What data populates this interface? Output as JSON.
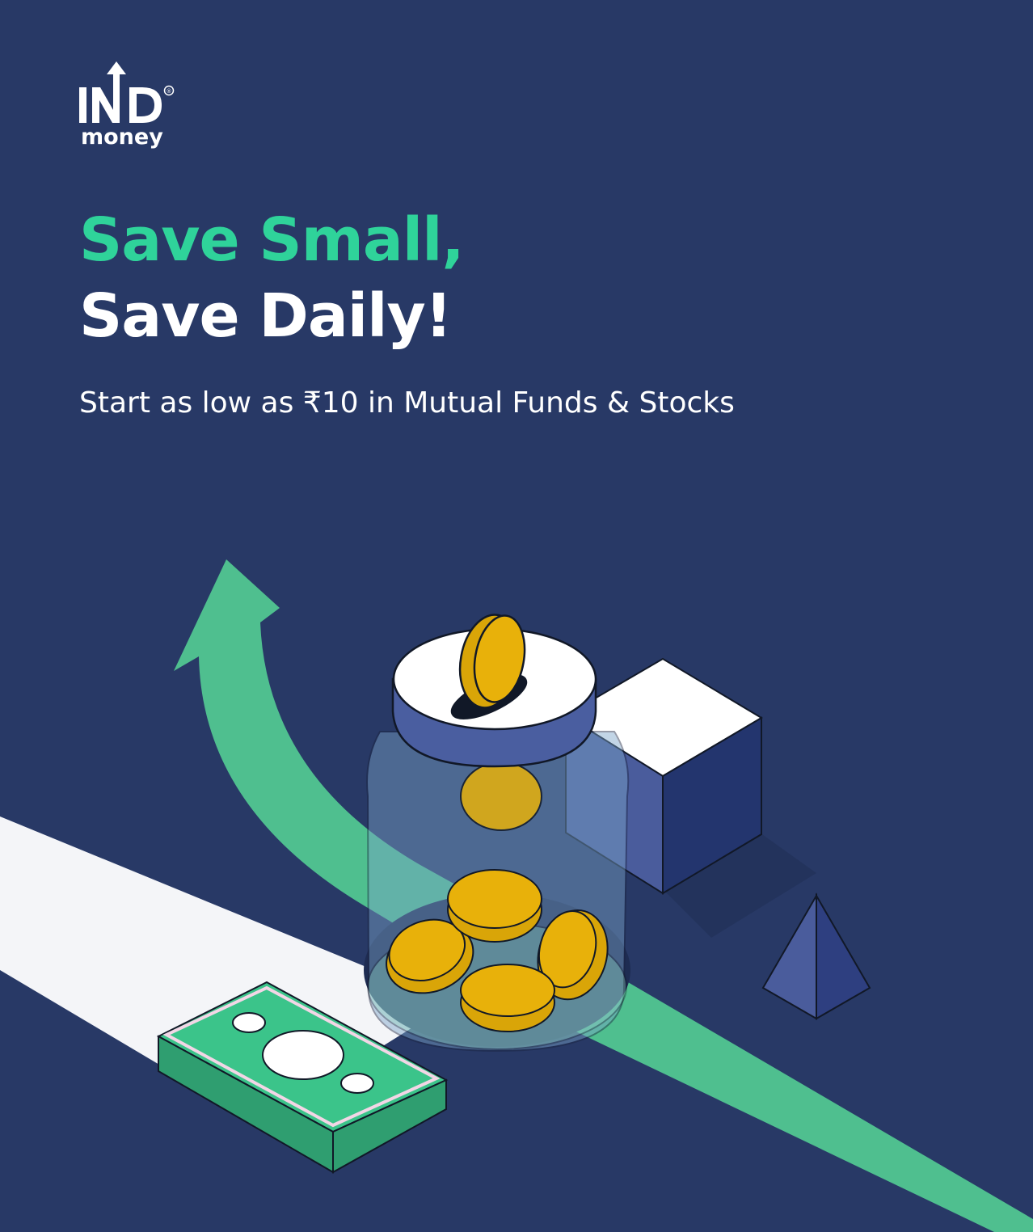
{
  "brand": {
    "logo_top": "IND",
    "logo_bottom": "money",
    "registered_mark": "®"
  },
  "headline": {
    "line1": "Save Small,",
    "line2": "Save Daily!"
  },
  "subheadline": "Start as low as ₹10 in Mutual Funds & Stocks",
  "colors": {
    "background": "#283966",
    "accent": "#2fd39a",
    "text": "#ffffff",
    "coin": "#e8b10a",
    "arrow": "#4fbf8f"
  },
  "icons": [
    "growth-arrow-icon",
    "money-jar-icon",
    "coin-icon",
    "cash-stack-icon",
    "cube-icon",
    "pyramid-icon"
  ]
}
